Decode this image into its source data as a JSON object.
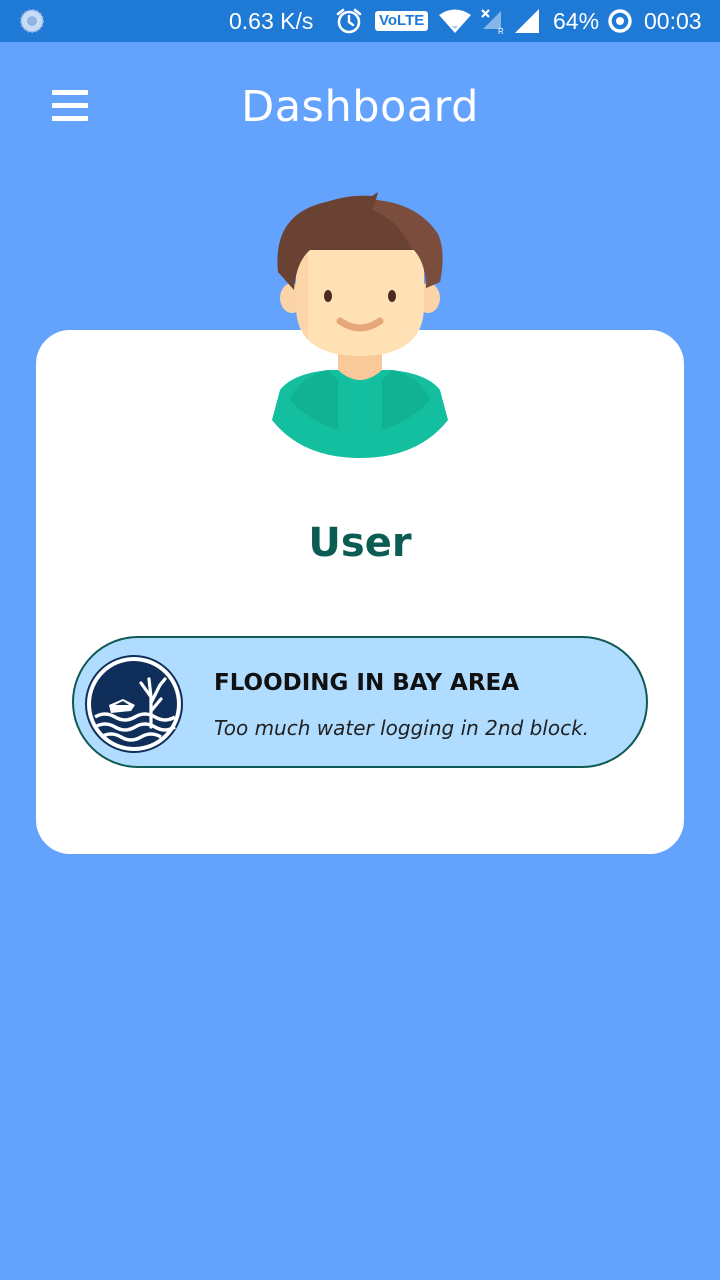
{
  "status_bar": {
    "network_speed": "0.63 K/s",
    "volte_label": "VoLTE",
    "battery": "64%",
    "time": "00:03",
    "icons": [
      "app-notification-icon",
      "alarm-icon",
      "volte-icon",
      "wifi-icon",
      "no-signal-sim-icon",
      "cellular-signal-icon",
      "battery-ring-icon"
    ]
  },
  "header": {
    "title": "Dashboard",
    "menu_icon": "hamburger-menu-icon"
  },
  "profile": {
    "name": "User",
    "avatar_icon": "user-avatar-icon"
  },
  "reports": [
    {
      "title": "FLOODING IN BAY AREA",
      "description": "Too much water logging in 2nd block.",
      "icon": "flood-icon"
    }
  ],
  "colors": {
    "background": "#64a3fd",
    "status_bar": "#1f7ad6",
    "card": "#ffffff",
    "username": "#0b5c52",
    "report_background": "#afdcff",
    "report_border": "#0f5a55",
    "icon_navy": "#0f2e5a"
  }
}
